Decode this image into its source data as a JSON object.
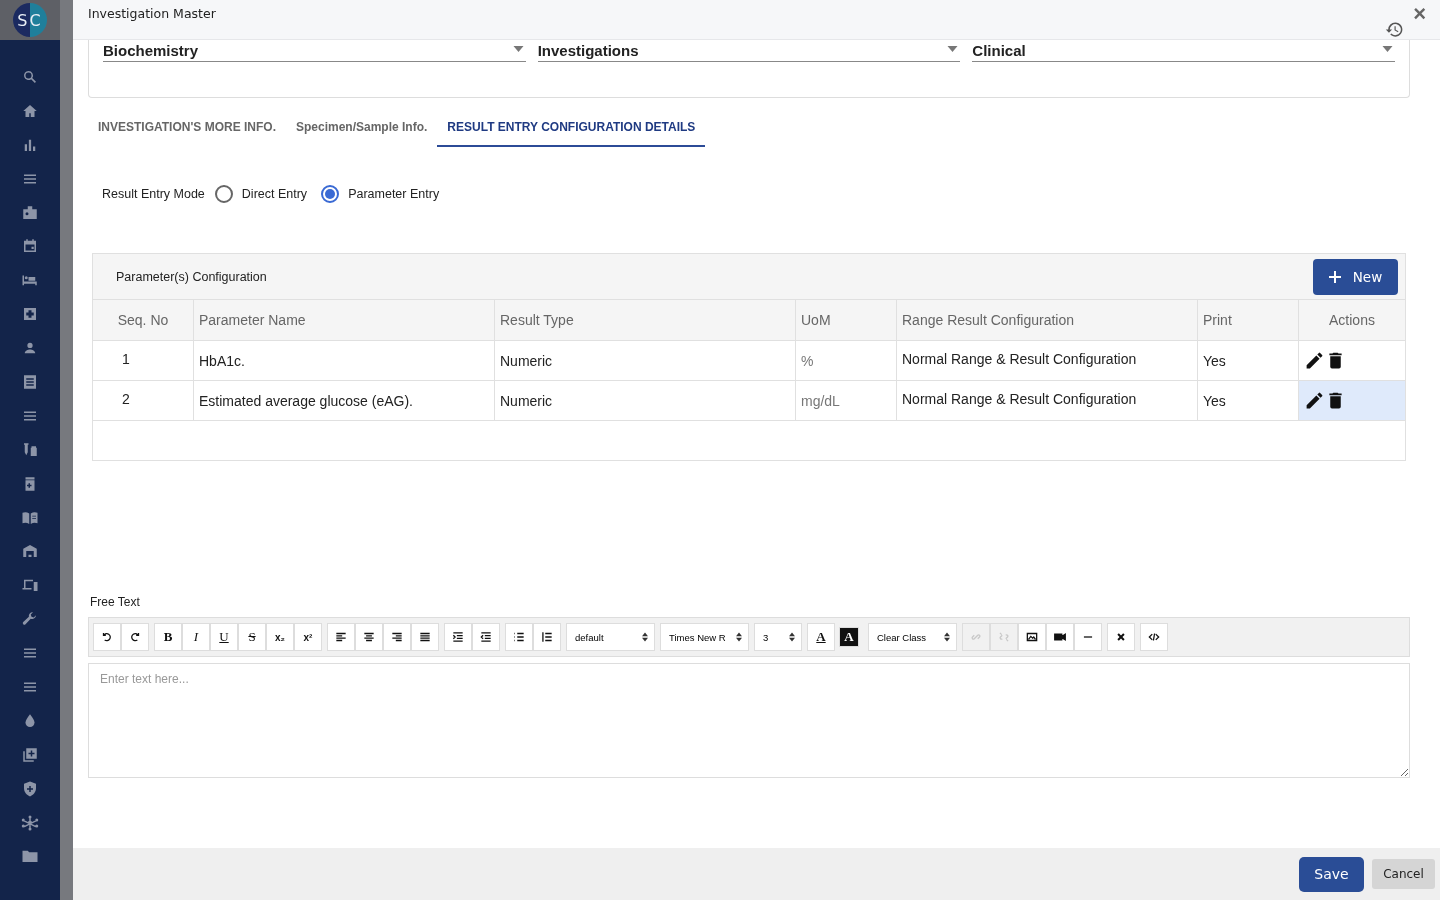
{
  "logo": {
    "text": "SC"
  },
  "window": {
    "title": "Investigation Master",
    "close": "×"
  },
  "filters": [
    {
      "value": "Biochemistry"
    },
    {
      "value": "Investigations"
    },
    {
      "value": "Clinical"
    }
  ],
  "tabs": [
    {
      "label": "INVESTIGATION'S MORE INFO.",
      "selected": false
    },
    {
      "label": "Specimen/Sample Info.",
      "selected": false
    },
    {
      "label": "RESULT ENTRY CONFIGURATION DETAILS",
      "selected": true
    }
  ],
  "result_entry_mode": {
    "label": "Result Entry Mode",
    "options": [
      {
        "label": "Direct Entry",
        "selected": false
      },
      {
        "label": "Parameter Entry",
        "selected": true
      }
    ]
  },
  "parameters": {
    "title": "Parameter(s) Configuration",
    "new_button": "New",
    "columns": [
      "Seq. No",
      "Parameter Name",
      "Result Type",
      "UoM",
      "Range Result Configuration",
      "Print",
      "Actions"
    ],
    "rows": [
      {
        "seq": "1",
        "name": "HbA1c.",
        "type": "Numeric",
        "uom": "%",
        "range": "Normal Range & Result Configuration",
        "print": "Yes",
        "highlighted": false
      },
      {
        "seq": "2",
        "name": "Estimated average glucose (eAG).",
        "type": "Numeric",
        "uom": "mg/dL",
        "range": "Normal Range & Result Configuration",
        "print": "Yes",
        "highlighted": true
      }
    ]
  },
  "free_text": {
    "label": "Free Text",
    "placeholder": "Enter text here...",
    "toolbar": [
      [
        {
          "kind": "undo",
          "disabled": false
        },
        {
          "kind": "redo",
          "disabled": false
        }
      ],
      [
        {
          "kind": "bold",
          "label": "B"
        },
        {
          "kind": "italic",
          "label": "I"
        },
        {
          "kind": "underline",
          "label": "U"
        },
        {
          "kind": "strike",
          "label": "S"
        },
        {
          "kind": "subscript",
          "label": "x₂"
        },
        {
          "kind": "superscript",
          "label": "x²"
        }
      ],
      [
        {
          "kind": "align-left",
          "disabled": false
        },
        {
          "kind": "align-center",
          "disabled": false
        },
        {
          "kind": "align-right",
          "disabled": false
        },
        {
          "kind": "justify",
          "disabled": false
        }
      ],
      [
        {
          "kind": "indent",
          "disabled": false
        },
        {
          "kind": "outdent",
          "disabled": false
        }
      ],
      [
        {
          "kind": "bullets",
          "disabled": false
        },
        {
          "kind": "numbers",
          "disabled": false
        }
      ],
      [
        {
          "kind": "select",
          "label": "default"
        }
      ],
      [
        {
          "kind": "select",
          "label": "Times New R"
        }
      ],
      [
        {
          "kind": "select",
          "label": "3"
        }
      ],
      [
        {
          "kind": "font-color",
          "label": "A"
        },
        {
          "kind": "highlight-color",
          "label": "A"
        }
      ],
      [
        {
          "kind": "select",
          "label": "Clear Class"
        }
      ],
      [
        {
          "kind": "link",
          "disabled": true
        },
        {
          "kind": "unlink",
          "disabled": true
        },
        {
          "kind": "image",
          "disabled": false
        },
        {
          "kind": "video",
          "disabled": false
        },
        {
          "kind": "rule",
          "disabled": false
        }
      ],
      [
        {
          "kind": "clear",
          "disabled": false
        }
      ],
      [
        {
          "kind": "code",
          "disabled": false
        }
      ]
    ]
  },
  "footer": {
    "save": "Save",
    "cancel": "Cancel"
  }
}
